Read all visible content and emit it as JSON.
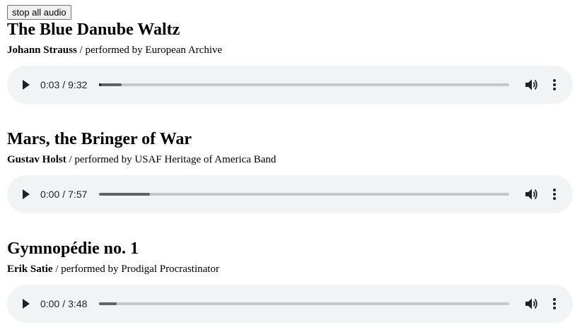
{
  "toolbar": {
    "stop_label": "stop all audio"
  },
  "tracks": [
    {
      "title": "The Blue Danube Waltz",
      "composer": "Johann Strauss",
      "performer_text": " / performed by European Archive",
      "current_time": "0:03",
      "duration": "9:32",
      "played_fraction": 0.005,
      "buffered_fraction": 0.055
    },
    {
      "title": "Mars, the Bringer of War",
      "composer": "Gustav Holst",
      "performer_text": " / performed by USAF Heritage of America Band",
      "current_time": "0:00",
      "duration": "7:57",
      "played_fraction": 0.0,
      "buffered_fraction": 0.124
    },
    {
      "title": "Gymnopédie no. 1",
      "composer": "Erik Satie",
      "performer_text": " / performed by Prodigal Procrastinator",
      "current_time": "0:00",
      "duration": "3:48",
      "played_fraction": 0.0,
      "buffered_fraction": 0.043
    }
  ],
  "colors": {
    "player_bg": "#f1f3f4",
    "icon": "#202124"
  }
}
